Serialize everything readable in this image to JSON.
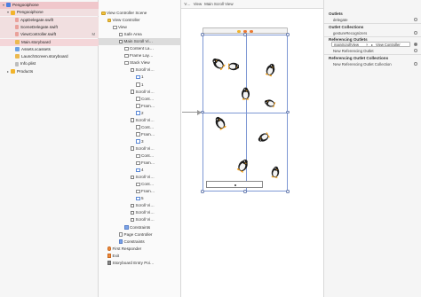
{
  "navigator": {
    "items": [
      {
        "label": "Pengooiphone",
        "icon": "project-icon",
        "indent": 0,
        "selected": "hl"
      },
      {
        "label": "Pengooiphone",
        "icon": "folder-icon",
        "indent": 1,
        "selected": "sel2"
      },
      {
        "label": "AppDelegate.swift",
        "icon": "swift-file-icon",
        "indent": 2,
        "selected": "sel2"
      },
      {
        "label": "SceneDelegate.swift",
        "icon": "swift-file-icon",
        "indent": 2,
        "selected": "sel2"
      },
      {
        "label": "ViewController.swift",
        "icon": "swift-file-icon",
        "indent": 2,
        "selected": "sel2",
        "mark": "M"
      },
      {
        "label": "Main.storyboard",
        "icon": "storyboard-icon",
        "indent": 2,
        "selected": "sel"
      },
      {
        "label": "Assets.xcassets",
        "icon": "asset-catalog-icon",
        "indent": 2,
        "selected": ""
      },
      {
        "label": "LaunchScreen.storyboard",
        "icon": "storyboard-icon",
        "indent": 2,
        "selected": ""
      },
      {
        "label": "Info.plist",
        "icon": "plist-icon",
        "indent": 2,
        "selected": ""
      },
      {
        "label": "Products",
        "icon": "folder-icon",
        "indent": 1,
        "selected": ""
      }
    ]
  },
  "jumpbar": {
    "items": [
      "‹",
      "›",
      "Pengooiphone",
      "P…",
      "P…",
      "M…",
      "M…",
      "V…",
      "V…",
      "View",
      "Main Scroll View"
    ]
  },
  "outline": {
    "rows": [
      {
        "label": "View Controller Scene",
        "indent": 0,
        "icon": "scene"
      },
      {
        "label": "View Controller",
        "indent": 1,
        "icon": "vc"
      },
      {
        "label": "View",
        "indent": 2,
        "icon": "view"
      },
      {
        "label": "Safe Area",
        "indent": 3,
        "icon": "view"
      },
      {
        "label": "Main Scroll Vi…",
        "indent": 3,
        "icon": "sv",
        "selected": true
      },
      {
        "label": "Content La…",
        "indent": 4,
        "icon": "view"
      },
      {
        "label": "Frame Lay…",
        "indent": 4,
        "icon": "view"
      },
      {
        "label": "Stack View",
        "indent": 4,
        "icon": "view"
      },
      {
        "label": "Scroll Vi…",
        "indent": 5,
        "icon": "sv"
      },
      {
        "label": "1",
        "indent": 6,
        "icon": "img"
      },
      {
        "label": "1",
        "indent": 6,
        "icon": "view"
      },
      {
        "label": "Scroll Vi…",
        "indent": 5,
        "icon": "sv"
      },
      {
        "label": "Cont…",
        "indent": 6,
        "icon": "view"
      },
      {
        "label": "Fram…",
        "indent": 6,
        "icon": "view"
      },
      {
        "label": "2",
        "indent": 6,
        "icon": "img"
      },
      {
        "label": "Scroll Vi…",
        "indent": 5,
        "icon": "sv"
      },
      {
        "label": "Cont…",
        "indent": 6,
        "icon": "view"
      },
      {
        "label": "Fram…",
        "indent": 6,
        "icon": "view"
      },
      {
        "label": "3",
        "indent": 6,
        "icon": "img"
      },
      {
        "label": "Scroll Vi…",
        "indent": 5,
        "icon": "sv"
      },
      {
        "label": "Cont…",
        "indent": 6,
        "icon": "view"
      },
      {
        "label": "Fram…",
        "indent": 6,
        "icon": "view"
      },
      {
        "label": "4",
        "indent": 6,
        "icon": "img"
      },
      {
        "label": "Scroll Vi…",
        "indent": 5,
        "icon": "sv"
      },
      {
        "label": "Cont…",
        "indent": 6,
        "icon": "view"
      },
      {
        "label": "Fram…",
        "indent": 6,
        "icon": "view"
      },
      {
        "label": "5",
        "indent": 6,
        "icon": "img"
      },
      {
        "label": "Scroll Vi…",
        "indent": 5,
        "icon": "sv"
      },
      {
        "label": "Scroll Vi…",
        "indent": 5,
        "icon": "sv"
      },
      {
        "label": "Scroll Vi…",
        "indent": 5,
        "icon": "sv"
      },
      {
        "label": "Constraints",
        "indent": 4,
        "icon": "con"
      },
      {
        "label": "Page Controller",
        "indent": 3,
        "icon": "view"
      },
      {
        "label": "Constraints",
        "indent": 3,
        "icon": "con"
      },
      {
        "label": "First Responder",
        "indent": 1,
        "icon": "resp"
      },
      {
        "label": "Exit",
        "indent": 1,
        "icon": "exit"
      },
      {
        "label": "Storyboard Entry Poi…",
        "indent": 1,
        "icon": "entry"
      }
    ]
  },
  "inspector": {
    "outlets_header": "Outlets",
    "outlets": [
      "delegate"
    ],
    "collections_header": "Outlet Collections",
    "collections": [
      "gestureRecognizers"
    ],
    "ref_outlets_header": "Referencing Outlets",
    "ref_outlet_from": "mainScrollView",
    "ref_outlet_to": "View Controller",
    "new_ref_outlet": "New Referencing Outlet",
    "ref_collections_header": "Referencing Outlet Collections",
    "new_ref_collection": "New Referencing Outlet Collection"
  },
  "colors": {
    "selection_pink": "#f4d6d9",
    "device_border": "#7e98d4",
    "scene_dot_yellow": "#f2b42b",
    "scene_dot_orange": "#ec7a32"
  }
}
